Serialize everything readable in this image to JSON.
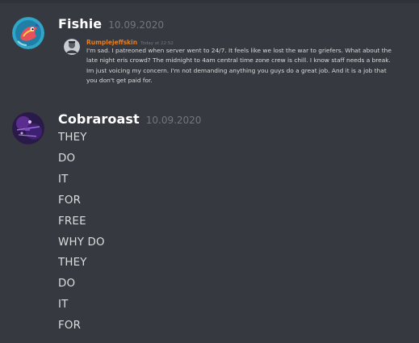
{
  "messages": [
    {
      "author": "Fishie",
      "date": "10.09.2020",
      "avatar_icon": "fish-avatar-icon",
      "quoted": {
        "author": "Rumplejeffskin",
        "author_color": "#e67e22",
        "time": "Today at 22:52",
        "text": "I'm sad. I patreoned when server went to 24/7. It feels like we lost the war to griefers. What about the late night eris crowd? The midnight to 4am central time zone crew is chill. I know staff needs a break. Im just voicing my concern. I'm not demanding anything you guys do a great job. And it is a job that you don't get paid for."
      }
    },
    {
      "author": "Cobraroast",
      "date": "10.09.2020",
      "avatar_icon": "purple-avatar-icon",
      "lines": [
        "THEY",
        "DO",
        "IT",
        "FOR",
        "FREE",
        "WHY DO",
        "THEY",
        "DO",
        "IT",
        "FOR"
      ]
    }
  ]
}
